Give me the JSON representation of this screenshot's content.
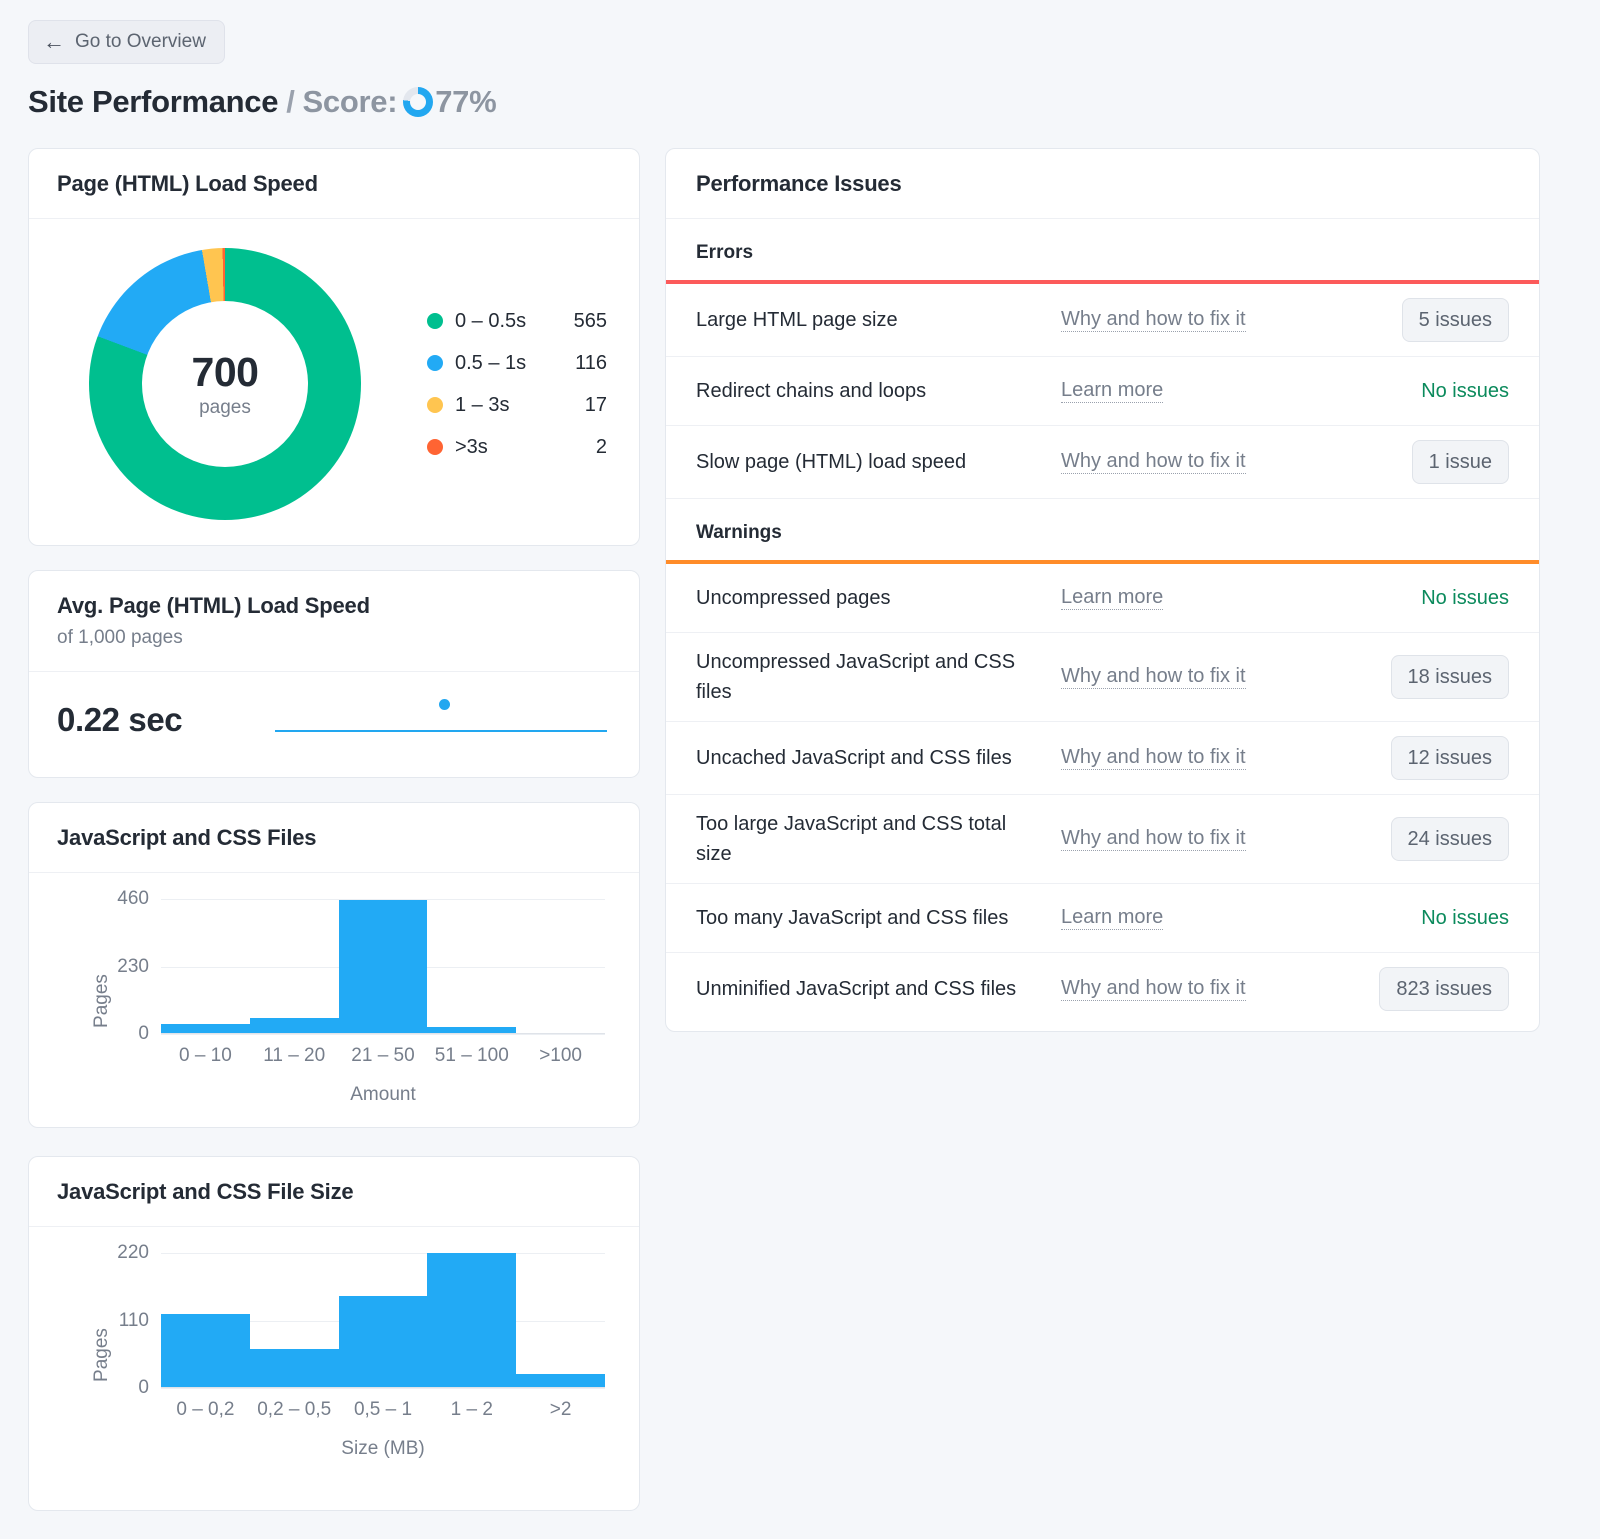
{
  "header": {
    "back_button": "Go to Overview",
    "back_icon": "arrow-left-icon",
    "title": "Site Performance",
    "separator": "/",
    "score_label": "Score:",
    "score_value": "77%",
    "score_percent": 77,
    "score_ring_color": "#22a7f0",
    "score_track_color": "#e3e7ee"
  },
  "load_speed_card": {
    "title": "Page (HTML) Load Speed",
    "center_value": "700",
    "center_unit": "pages"
  },
  "avg_speed_card": {
    "title": "Avg. Page (HTML) Load Speed",
    "subtitle": "of 1,000 pages",
    "value": "0.22 sec",
    "marker_position_percent": 49.5
  },
  "issues_panel": {
    "title": "Performance Issues",
    "groups": [
      {
        "name": "Errors",
        "rule_color": "#fc5a5a",
        "rows": [
          {
            "name": "Large HTML page size",
            "link": "Why and how to fix it",
            "status": "5 issues",
            "has_badge": true
          },
          {
            "name": "Redirect chains and loops",
            "link": "Learn more",
            "status": "No issues",
            "has_badge": false
          },
          {
            "name": "Slow page (HTML) load speed",
            "link": "Why and how to fix it",
            "status": "1 issue",
            "has_badge": true
          }
        ]
      },
      {
        "name": "Warnings",
        "rule_color": "#ff8c29",
        "rows": [
          {
            "name": "Uncompressed pages",
            "link": "Learn more",
            "status": "No issues",
            "has_badge": false
          },
          {
            "name": "Uncompressed JavaScript and CSS files",
            "link": "Why and how to fix it",
            "status": "18 issues",
            "has_badge": true
          },
          {
            "name": "Uncached JavaScript and CSS files",
            "link": "Why and how to fix it",
            "status": "12 issues",
            "has_badge": true
          },
          {
            "name": "Too large JavaScript and CSS total size",
            "link": "Why and how to fix it",
            "status": "24 issues",
            "has_badge": true
          },
          {
            "name": "Too many JavaScript and CSS files",
            "link": "Learn more",
            "status": "No issues",
            "has_badge": false
          },
          {
            "name": "Unminified JavaScript and CSS files",
            "link": "Why and how to fix it",
            "status": "823 issues",
            "has_badge": true
          }
        ]
      }
    ]
  },
  "chart_data": [
    {
      "type": "pie",
      "title": "Page (HTML) Load Speed",
      "center_label": "700",
      "center_sublabel": "pages",
      "total": 700,
      "categories": [
        "0 – 0.5s",
        "0.5 – 1s",
        "1 – 3s",
        ">3s"
      ],
      "values": [
        565,
        116,
        17,
        2
      ],
      "colors": [
        "#00bf8f",
        "#22aaf5",
        "#ffc550",
        "#ff6433"
      ],
      "legend": "right",
      "donut": true
    },
    {
      "type": "bar",
      "title": "JavaScript and CSS Files",
      "categories": [
        "0 – 10",
        "11 – 20",
        "21 – 50",
        "51 – 100",
        ">100"
      ],
      "values": [
        32,
        50,
        455,
        22,
        0
      ],
      "xlabel": "Amount",
      "ylabel": "Pages",
      "yticks": [
        0,
        230,
        460
      ],
      "ylim": [
        0,
        460
      ],
      "bar_color": "#22aaf5",
      "grid": true
    },
    {
      "type": "bar",
      "title": "JavaScript and CSS File Size",
      "categories": [
        "0 – 0,2",
        "0,2 – 0,5",
        "0,5 – 1",
        "1 – 2",
        ">2"
      ],
      "values": [
        120,
        62,
        150,
        220,
        22
      ],
      "xlabel": "Size (MB)",
      "ylabel": "Pages",
      "yticks": [
        0,
        110,
        220
      ],
      "ylim": [
        0,
        220
      ],
      "bar_color": "#22aaf5",
      "grid": true
    }
  ]
}
